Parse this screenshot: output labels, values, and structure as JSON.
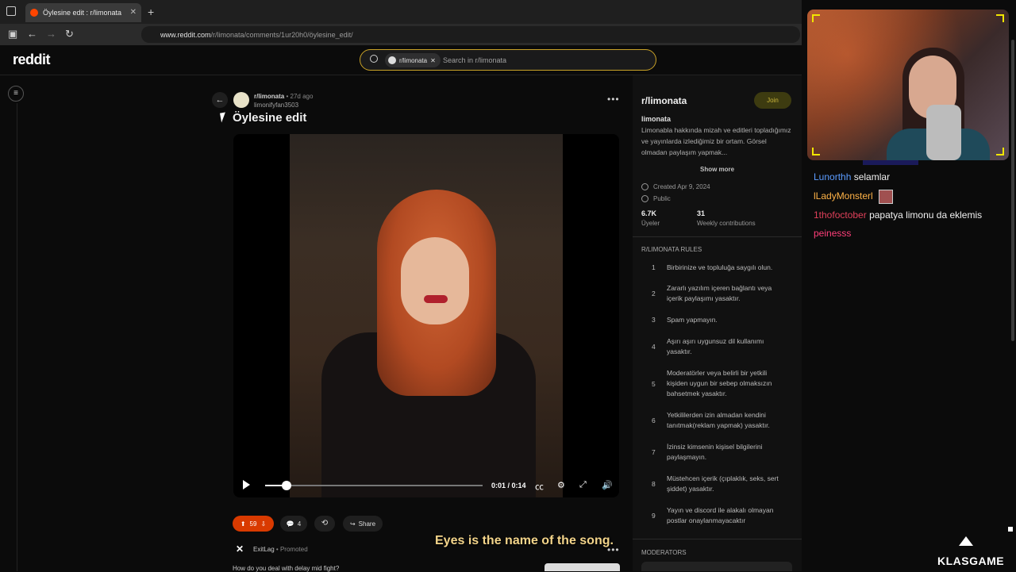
{
  "browser": {
    "tab_title": "Öylesine edit : r/limonata",
    "url_host": "www.reddit.com",
    "url_path": "/r/limonata/comments/1ur20h0/öylesine_edit/"
  },
  "header": {
    "logo": "reddit",
    "search_chip": "r/limonata",
    "search_placeholder": "Search in r/limonata"
  },
  "post": {
    "subreddit": "r/limonata",
    "age": "• 27d ago",
    "author": "limonifyfan3503",
    "title": "Öylesine edit",
    "video": {
      "time": "0:01 / 0:14",
      "progress": 0.1
    },
    "votes": "59",
    "comments": "4",
    "share": "Share"
  },
  "promoted": {
    "name": "ExitLag",
    "tag": "Promoted",
    "text": "How do you deal with delay mid fight?"
  },
  "overlay_caption": "Eyes is the name of the song.",
  "sidebar": {
    "name": "r/limonata",
    "join": "Join",
    "title": "limonata",
    "description": "Limonabla hakkında mizah ve editleri topladığımız ve yayınlarda izlediğimiz bir ortam. Görsel olmadan paylaşım yapmak...",
    "show_more": "Show more",
    "created": "Created Apr 9, 2024",
    "visibility": "Public",
    "members_value": "6.7K",
    "members_label": "Üyeler",
    "contrib_value": "31",
    "contrib_label": "Weekly contributions",
    "rules_header": "R/LIMONATA RULES",
    "rules": [
      {
        "n": "1",
        "t": "Birbirinize ve topluluğa saygılı olun."
      },
      {
        "n": "2",
        "t": "Zararlı yazılım içeren bağlantı veya içerik paylaşımı yasaktır."
      },
      {
        "n": "3",
        "t": "Spam yapmayın."
      },
      {
        "n": "4",
        "t": "Aşırı aşırı uygunsuz dil kullanımı yasaktır."
      },
      {
        "n": "5",
        "t": "Moderatörler veya belirli bir yetkili kişiden uygun bir sebep olmaksızın bahsetmek yasaktır."
      },
      {
        "n": "6",
        "t": "Yetkililerden izin almadan kendini tanıtmak(reklam yapmak) yasaktır."
      },
      {
        "n": "7",
        "t": "İzinsiz kimsenin kişisel bilgilerini paylaşmayın."
      },
      {
        "n": "8",
        "t": "Müstehcen içerik (çıplaklık, seks, sert şiddet) yasaktır."
      },
      {
        "n": "9",
        "t": "Yayın ve discord ile alakalı olmayan postlar onaylanmayacaktır"
      }
    ],
    "moderators_header": "MODERATORS"
  },
  "chat": [
    {
      "user": "Lunorthh",
      "color": "#5b9cff",
      "msg": "selamlar"
    },
    {
      "user": "lLadyMonsterl",
      "color": "#ffb347",
      "msg": ""
    },
    {
      "user": "1thofoctober",
      "color": "#e0405a",
      "msg": "papatya limonu da eklemis"
    },
    {
      "user": "peinesss",
      "color": "#ff3f7a",
      "msg": ""
    }
  ],
  "brand": "KLASGAME",
  "colors": {
    "accent": "#ff4500",
    "upvote_bg": "#d93a00",
    "search_border": "#c9a227"
  }
}
